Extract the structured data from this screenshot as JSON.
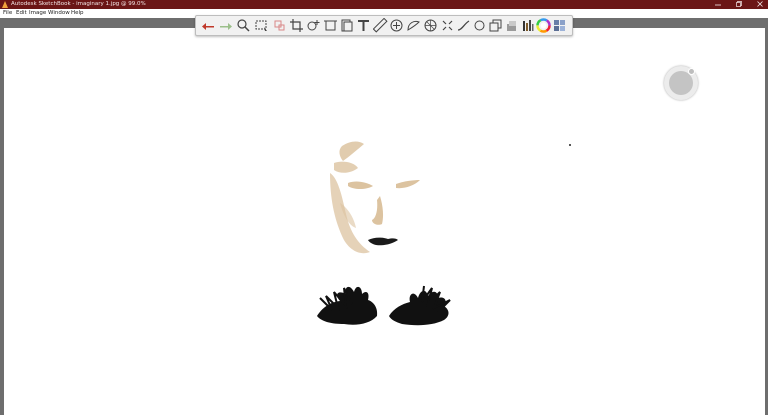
{
  "window": {
    "title": "Autodesk SketchBook - imaginary 1.jpg @ 99.0%",
    "minimize_icon": "minimize-icon",
    "restore_icon": "restore-icon",
    "close_icon": "close-icon"
  },
  "menu": {
    "items": [
      "File",
      "Edit",
      "Image",
      "Window",
      "Help"
    ]
  },
  "toolbar": {
    "tools": [
      "undo-icon",
      "redo-icon",
      "zoom-icon",
      "select-icon",
      "transform-icon",
      "crop-icon",
      "text-insert-icon",
      "canvas-size-icon",
      "add-image-icon",
      "text-icon",
      "ruler-icon",
      "ellipse-guide-icon",
      "french-curve-icon",
      "perspective-icon",
      "symmetry-icon",
      "stroke-icon",
      "shape-icon",
      "fill-icon",
      "layers-icon",
      "brush-library-icon",
      "color-wheel-icon",
      "copic-library-icon"
    ]
  },
  "colors": {
    "titlebar": "#6b1616",
    "undo": "#c0392b",
    "redo": "#9bbf8a",
    "skin": "#dcc3a0",
    "lashes": "#111111"
  },
  "puck": {
    "icon": "lagoon-puck-icon"
  }
}
